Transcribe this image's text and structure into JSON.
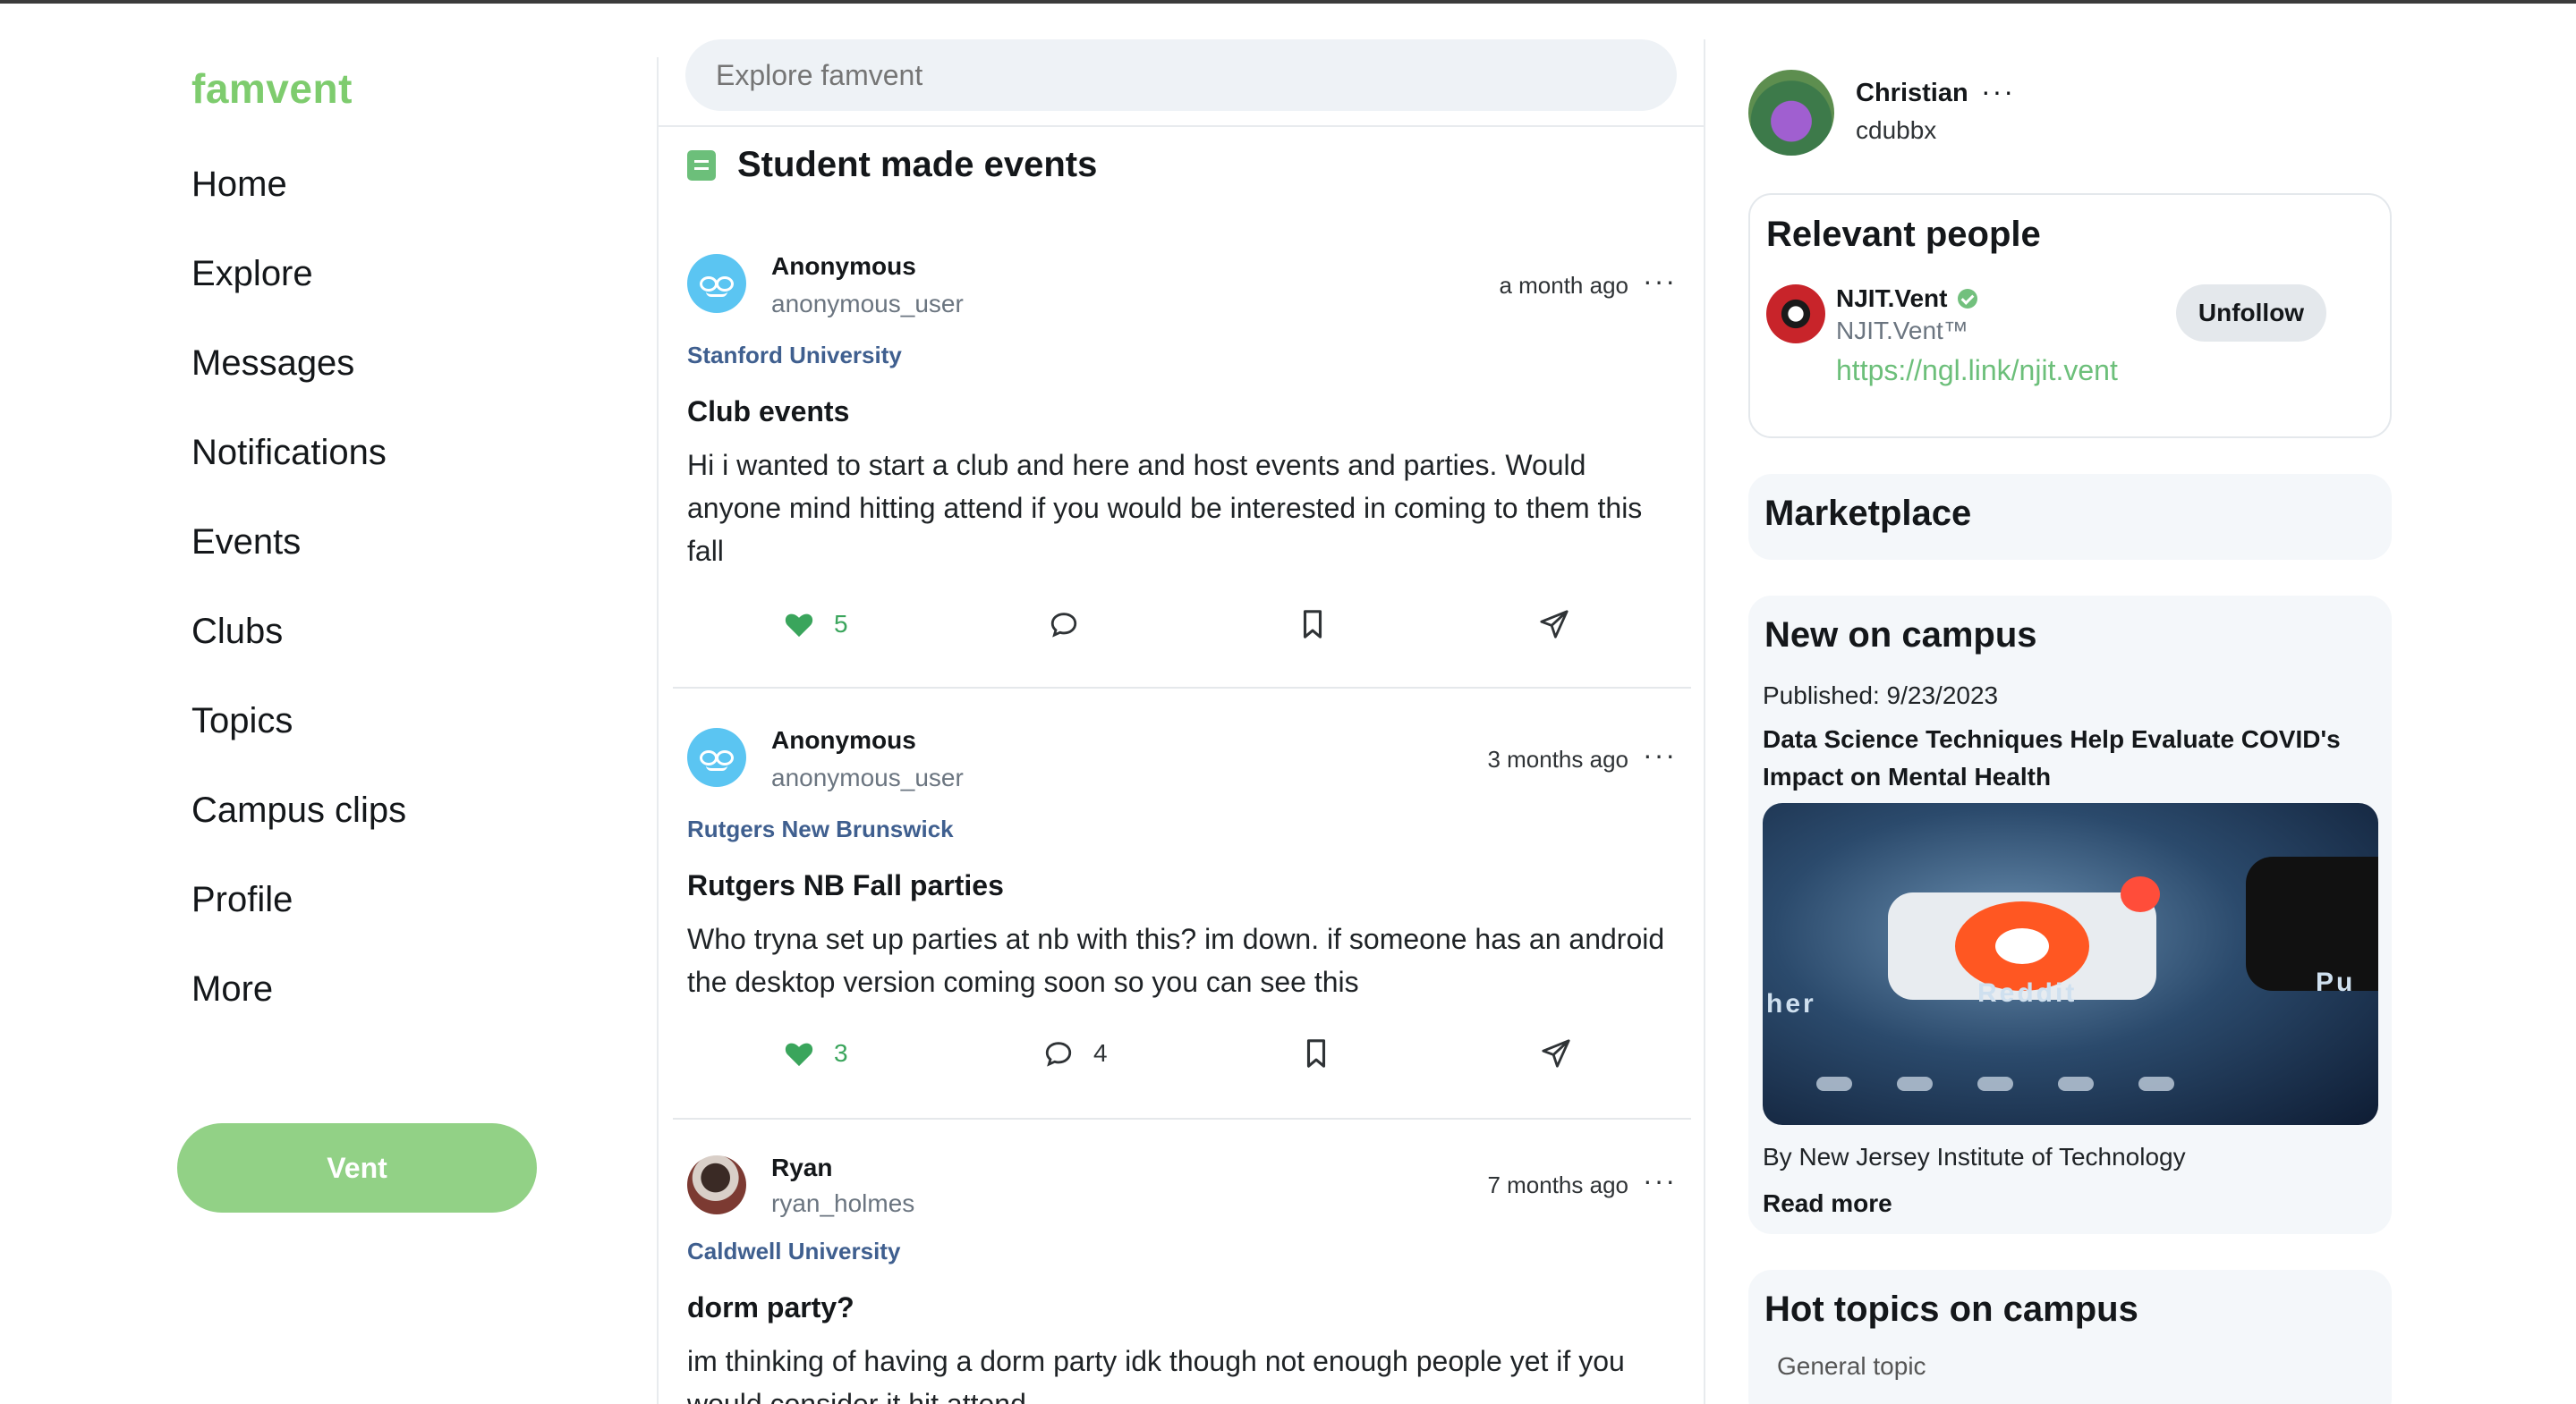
{
  "brand": "famvent",
  "nav": [
    {
      "label": "Home",
      "name": "nav-home"
    },
    {
      "label": "Explore",
      "name": "nav-explore"
    },
    {
      "label": "Messages",
      "name": "nav-messages"
    },
    {
      "label": "Notifications",
      "name": "nav-notifications"
    },
    {
      "label": "Events",
      "name": "nav-events"
    },
    {
      "label": "Clubs",
      "name": "nav-clubs"
    },
    {
      "label": "Topics",
      "name": "nav-topics"
    },
    {
      "label": "Campus clips",
      "name": "nav-campus-clips"
    },
    {
      "label": "Profile",
      "name": "nav-profile"
    },
    {
      "label": "More",
      "name": "nav-more"
    }
  ],
  "vent_button": "Vent",
  "search": {
    "placeholder": "Explore famvent"
  },
  "feed": {
    "title": "Student made events",
    "title_icon": "document-list-icon",
    "posts": [
      {
        "author": "Anonymous",
        "username": "anonymous_user",
        "time": "a month ago",
        "school": "Stanford University",
        "title": "Club events",
        "body": "Hi i wanted to start a club and here and host events and parties. Would anyone mind hitting attend if you would be interested in coming to them this fall",
        "likes": "5",
        "comments": ""
      },
      {
        "author": "Anonymous",
        "username": "anonymous_user",
        "time": "3 months ago",
        "school": "Rutgers New Brunswick",
        "title": "Rutgers NB Fall parties",
        "body": "Who tryna set up parties at nb with this? im down. if someone has an android the desktop version coming soon so you can see this",
        "likes": "3",
        "comments": "4"
      },
      {
        "author": "Ryan",
        "username": "ryan_holmes",
        "time": "7 months ago",
        "school": "Caldwell University",
        "title": "dorm party?",
        "body": "im thinking of having a dorm party idk though not enough people yet if you would consider it hit attend",
        "likes": "",
        "comments": ""
      }
    ],
    "more_glyph": "···"
  },
  "me": {
    "name": "Christian",
    "username": "cdubbx",
    "more_glyph": "···"
  },
  "relevant": {
    "heading": "Relevant people",
    "person": {
      "name": "NJIT.Vent",
      "handle": "NJIT.Vent™",
      "link": "https://ngl.link/njit.vent",
      "button": "Unfollow"
    }
  },
  "marketplace": {
    "heading": "Marketplace"
  },
  "news": {
    "heading": "New on campus",
    "published": "Published: 9/23/2023",
    "title": "Data Science Techniques Help Evaluate COVID's Impact on Mental Health",
    "image_labels": [
      "her",
      "Reddit",
      "Pu"
    ],
    "by": "By New Jersey Institute of Technology",
    "read_more": "Read more"
  },
  "hot": {
    "heading": "Hot topics on campus",
    "sub": "General topic"
  },
  "colors": {
    "brand": "#7ecc6e",
    "like": "#3aa55c",
    "school": "#3f5f8f",
    "link": "#6cbf7a"
  }
}
